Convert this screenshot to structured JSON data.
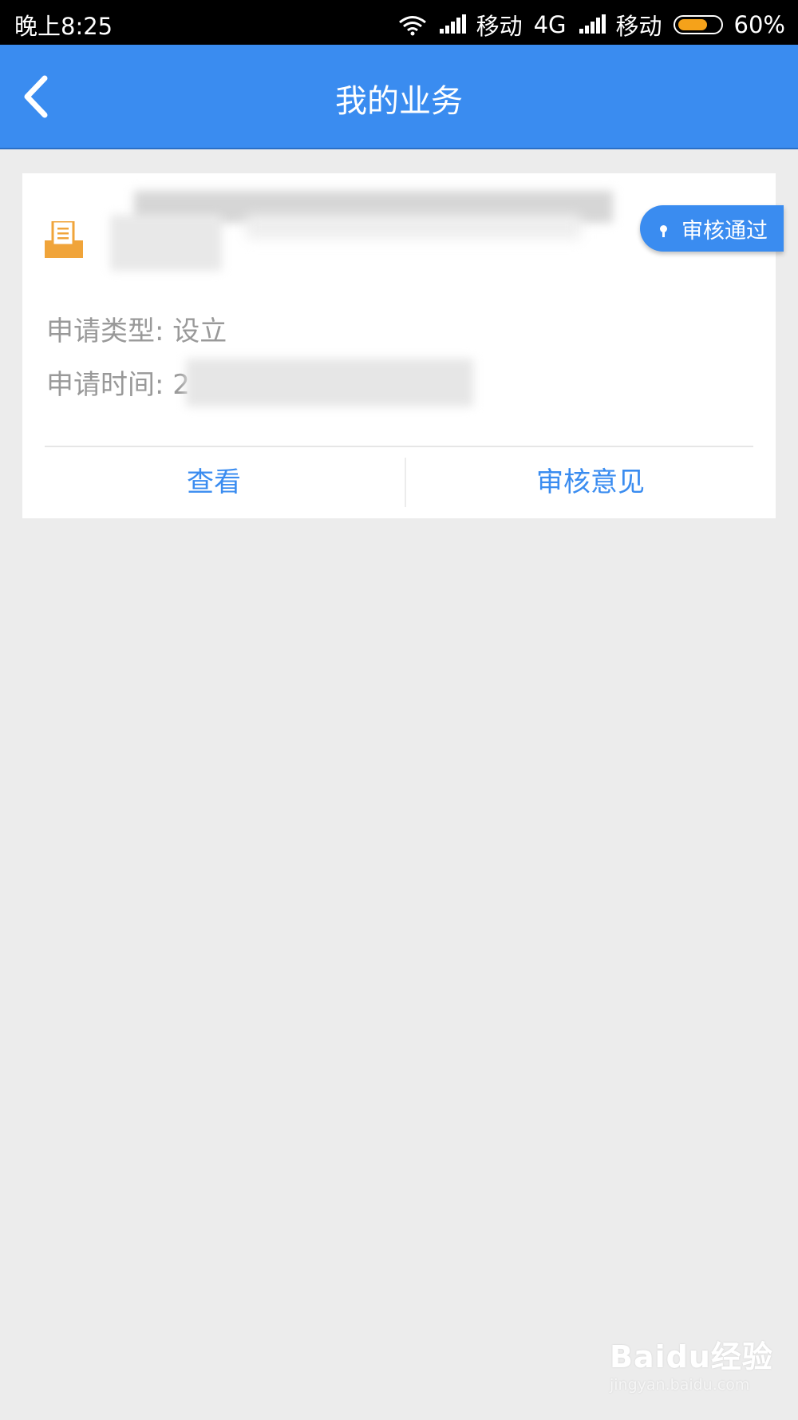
{
  "status_bar": {
    "time": "晚上8:25",
    "carrier1_label": "移动",
    "network_type": "4G",
    "carrier2_label": "移动",
    "battery_level": "60%"
  },
  "nav": {
    "back_icon": "chevron-left-icon",
    "title": "我的业务"
  },
  "card": {
    "icon": "document-icon",
    "status_badge": "审核通过",
    "apply_type_label": "申请类型:",
    "apply_type_value": "设立",
    "apply_time_label": "申请时间:",
    "apply_time_value": "2",
    "actions": {
      "view": "查看",
      "opinion": "审核意见"
    }
  },
  "colors": {
    "primary": "#3a8cf0",
    "icon_orange": "#f0a43a",
    "background": "#ececec"
  },
  "watermark": {
    "main": "Baidu经验",
    "sub": "jingyan.baidu.com"
  }
}
